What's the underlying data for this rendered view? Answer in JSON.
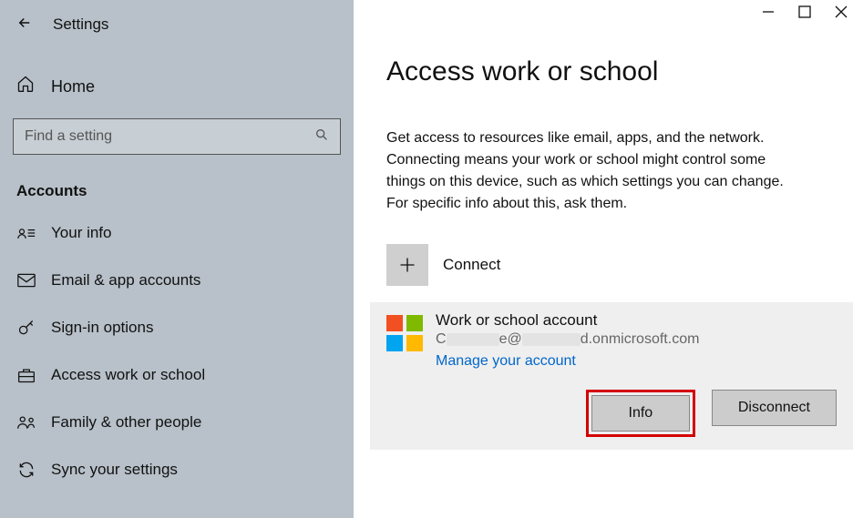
{
  "header": {
    "title": "Settings"
  },
  "home_label": "Home",
  "search": {
    "placeholder": "Find a setting"
  },
  "section_title": "Accounts",
  "nav": [
    {
      "label": "Your info"
    },
    {
      "label": "Email & app accounts"
    },
    {
      "label": "Sign-in options"
    },
    {
      "label": "Access work or school"
    },
    {
      "label": "Family & other people"
    },
    {
      "label": "Sync your settings"
    }
  ],
  "main": {
    "title": "Access work or school",
    "description": "Get access to resources like email, apps, and the network. Connecting means your work or school might control some things on this device, such as which settings you can change. For specific info about this, ask them.",
    "connect_label": "Connect",
    "account": {
      "title": "Work or school account",
      "email_prefix": "C",
      "email_mid": "e@",
      "email_suffix": "d.onmicrosoft.com",
      "manage_link": "Manage your account"
    },
    "buttons": {
      "info": "Info",
      "disconnect": "Disconnect"
    }
  }
}
